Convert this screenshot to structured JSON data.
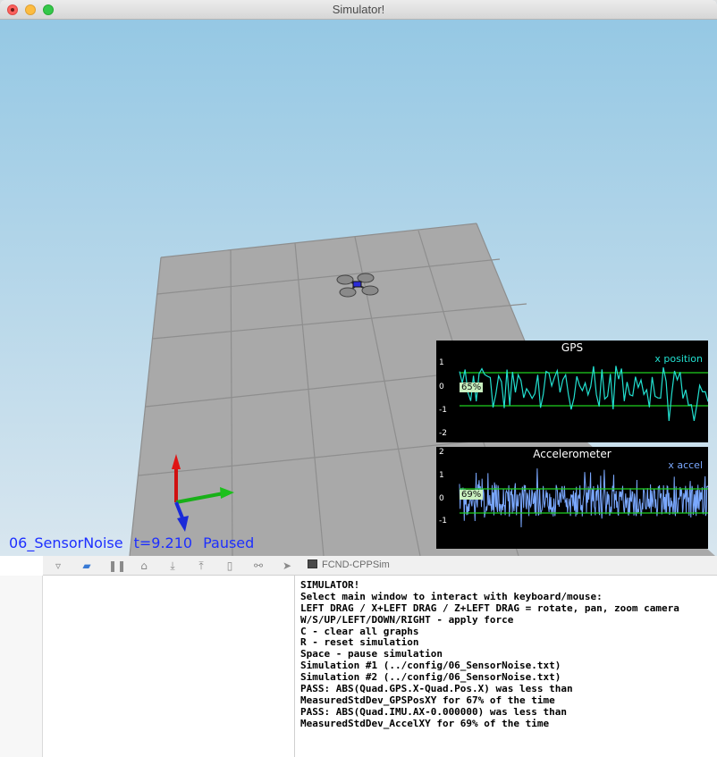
{
  "window": {
    "title": "Simulator!",
    "buttons": [
      "close",
      "minimize",
      "zoom"
    ]
  },
  "status": {
    "scenario": "06_SensorNoise",
    "time": "t=9.210",
    "state": "Paused"
  },
  "graphs": {
    "gps": {
      "title": "GPS",
      "legend": "x position",
      "color": "#22e0d0",
      "yticks": [
        "1",
        "0",
        "-1",
        "-2"
      ],
      "percent": "65%"
    },
    "accel": {
      "title": "Accelerometer",
      "legend": "x accel",
      "color": "#7aa8ff",
      "yticks": [
        "2",
        "1",
        "0",
        "-1"
      ],
      "percent": "69%"
    }
  },
  "xcode": {
    "target": "FCND-CPPSim",
    "toolbar_icons": [
      "hide-debug-area-icon",
      "breakpoint-icon",
      "pause-icon",
      "step-over-icon",
      "step-into-icon",
      "step-out-icon",
      "view-hierarchy-icon",
      "memory-graph-icon",
      "location-icon"
    ]
  },
  "console": {
    "lines": [
      "SIMULATOR!",
      "Select main window to interact with keyboard/mouse:",
      "LEFT DRAG / X+LEFT DRAG / Z+LEFT DRAG = rotate, pan, zoom camera",
      "W/S/UP/LEFT/DOWN/RIGHT - apply force",
      "C - clear all graphs",
      "R - reset simulation",
      "Space - pause simulation",
      "Simulation #1 (../config/06_SensorNoise.txt)",
      "Simulation #2 (../config/06_SensorNoise.txt)",
      "PASS: ABS(Quad.GPS.X-Quad.Pos.X) was less than",
      "MeasuredStdDev_GPSPosXY for 67% of the time",
      "PASS: ABS(Quad.IMU.AX-0.000000) was less than",
      "MeasuredStdDev_AccelXY for 69% of the time"
    ]
  }
}
